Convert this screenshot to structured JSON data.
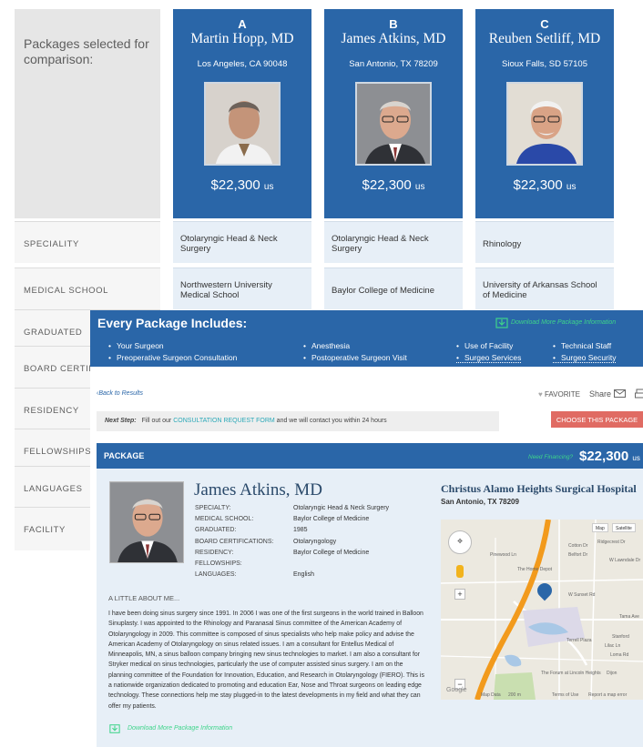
{
  "comparison": {
    "heading": "Packages selected for comparison:",
    "doctors": [
      {
        "letter": "A",
        "name": "Martin Hopp, MD",
        "location": "Los Angeles, CA 90048",
        "price": "$22,300",
        "currency": "us",
        "speciality": "Otolaryngic Head & Neck Surgery",
        "medical_school": "Northwestern University Medical School"
      },
      {
        "letter": "B",
        "name": "James Atkins, MD",
        "location": "San Antonio, TX 78209",
        "price": "$22,300",
        "currency": "us",
        "speciality": "Otolaryngic Head & Neck Surgery",
        "medical_school": "Baylor College of Medicine"
      },
      {
        "letter": "C",
        "name": "Reuben Setliff, MD",
        "location": "Sioux Falls, SD 57105",
        "price": "$22,300",
        "currency": "us",
        "speciality": "Rhinology",
        "medical_school": "University of Arkansas School of Medicine"
      }
    ],
    "row_labels": [
      "SPECIALITY",
      "MEDICAL SCHOOL",
      "GRADUATED",
      "BOARD CERTIFI",
      "RESIDENCY",
      "FELLOWSHIPS",
      "LANGUAGES",
      "FACILITY"
    ]
  },
  "package_page": {
    "includes_title": "Every Package Includes:",
    "download_link": "Download More Package Information",
    "includes": [
      "Your Surgeon",
      "Preoperative Surgeon Consultation",
      "Anesthesia",
      "Postoperative Surgeon Visit",
      "Use of Facility",
      "Surgeo Services",
      "Technical Staff",
      "Surgeo Security"
    ],
    "back_link": "‹Back to Results",
    "favorite": "FAVORITE",
    "share": "Share",
    "next_step_label": "Next Step:",
    "next_step_pre": "Fill out our",
    "next_step_link": "CONSULTATION REQUEST FORM",
    "next_step_post": "and we will contact you within 24 hours",
    "choose_button": "CHOOSE THIS PACKAGE",
    "package_label": "PACKAGE",
    "need_financing": "Need Financing?",
    "price": "$22,300",
    "currency": "us",
    "doctor": {
      "name": "James Atkins, MD",
      "fields": [
        {
          "key": "SPECIALTY:",
          "value": "Otolaryngic Head & Neck Surgery"
        },
        {
          "key": "MEDICAL SCHOOL:",
          "value": "Baylor College of Medicine"
        },
        {
          "key": "GRADUATED:",
          "value": "1985"
        },
        {
          "key": "BOARD CERTIFICATIONS:",
          "value": "Otolaryngology"
        },
        {
          "key": "RESIDENCY:",
          "value": "Baylor College of Medicine"
        },
        {
          "key": "FELLOWSHIPS:",
          "value": ""
        },
        {
          "key": "LANGUAGES:",
          "value": "English"
        }
      ]
    },
    "hospital": "Christus Alamo Heights Surgical Hospital",
    "hospital_city": "San Antonio, TX 78209",
    "about_heading": "A LITTLE ABOUT ME...",
    "bio": "I have been doing sinus surgery since 1991. In 2006 I was one of the first surgeons in the world trained in Balloon Sinuplasty. I was appointed to the Rhinology and Paranasal Sinus committee of the American Academy of Otolaryngology in 2009. This committee is composed of sinus specialists who help make policy and advise the American Academy of Otolaryngology on sinus related issues. I am a consultant for Entellus Medical of Minneapolis, MN, a sinus balloon company bringing new sinus technologies to market. I am also a consultant for Stryker medical on sinus technologies, particularly the use of computer assisted sinus surgery. I am on the planning committee of the Foundation for Innovation, Education, and Research in Otolaryngology (FIERO). This is a nationwide organization dedicated to promoting and education Ear, Nose and Throat surgeons on leading edge technology. These connections help me stay plugged-in to the latest developments in my field and what they can offer my patients.",
    "download_link_bottom": "Download More Package Information",
    "map": {
      "map_button": "Map",
      "satellite_button": "Satellite",
      "labels": [
        "Ridgecrest Dr",
        "Cotton Dr",
        "Belfort Dr",
        "W Lawndale Dr",
        "Pinewood Ln",
        "The Home Depot",
        "W Sunset Rd",
        "Tama Ave",
        "Stanford",
        "Lilac Ln",
        "Loma Rd",
        "Dijon",
        "The Forum at Lincoln Heights",
        "Terrell Plaza",
        "Google",
        "Map Data",
        "200 m",
        "Terms of Use",
        "Report a map error"
      ]
    }
  },
  "colors": {
    "brand_blue": "#2a66a8",
    "light_blue": "#e7eff7",
    "green_link": "#3ed48a",
    "cta_red": "#e06b63"
  }
}
